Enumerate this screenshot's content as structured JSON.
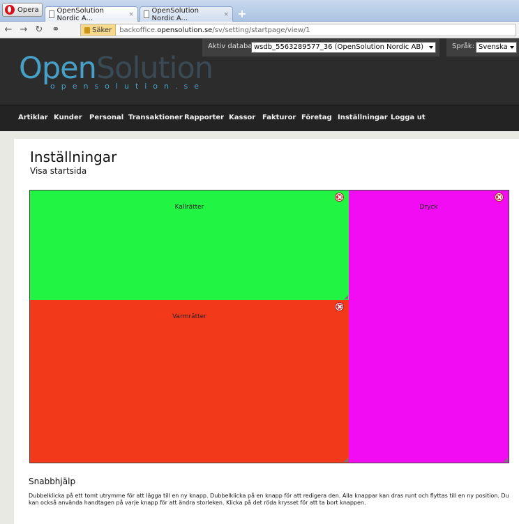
{
  "browser": {
    "menu_label": "Opera",
    "tabs": [
      {
        "title": "OpenSolution Nordic A...",
        "close": "×"
      },
      {
        "title": "OpenSolution Nordic A...",
        "close": "×"
      }
    ],
    "new_tab": "+",
    "secure_label": "Säker",
    "url_prefix": "backoffice.",
    "url_domain": "opensolution.se",
    "url_path": "/sv/setting/startpage/view/1"
  },
  "header": {
    "logo_open": "Open",
    "logo_solution": "Solution",
    "logo_sub": "opensolution.se",
    "db_label": "Aktiv databas:",
    "db_value": "wsdb_5563289577_36 (OpenSolution Nordic AB)",
    "lang_label": "Språk:",
    "lang_value": "Svenska"
  },
  "nav": {
    "items": [
      "Artiklar",
      "Kunder",
      "Personal",
      "Transaktioner",
      "Rapporter",
      "Kassor",
      "Fakturor",
      "Företag",
      "Inställningar",
      "Logga ut"
    ]
  },
  "page": {
    "title": "Inställningar",
    "subtitle": "Visa startsida"
  },
  "tiles": [
    {
      "label": "Kallrätter",
      "color": "#22f444"
    },
    {
      "label": "Dryck",
      "color": "#f20cf4"
    },
    {
      "label": "Varmrätter",
      "color": "#f23a1a"
    }
  ],
  "help": {
    "title": "Snabbhjälp",
    "text": "Dubbelklicka på ett tomt utrymme för att lägga till en ny knapp. Dubbelklicka på en knapp för att redigera den. Alla knappar kan dras runt och flyttas till en ny position. Du kan också använda handtagen på varje knapp för att ändra storleken. Klicka på det röda krysset för att ta bort knappen."
  }
}
